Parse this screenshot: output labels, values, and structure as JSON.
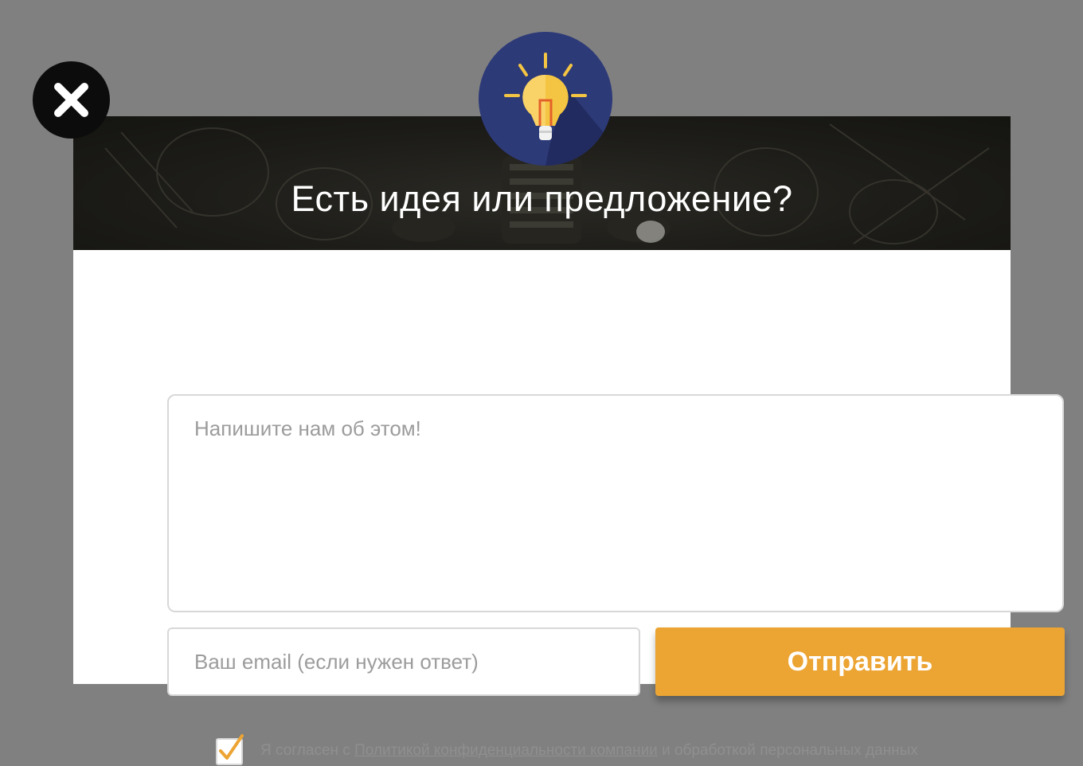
{
  "modal": {
    "title": "Есть идея или предложение?",
    "icon": "lightbulb-icon",
    "close_icon": "close-icon"
  },
  "form": {
    "message_placeholder": "Напишите нам об этом!",
    "message_value": "",
    "email_placeholder": "Ваш email (если нужен ответ)",
    "email_value": "",
    "submit_label": "Отправить",
    "consent": {
      "checked": true,
      "text_before": "Я согласен с ",
      "link_text": "Политикой конфиденциальности компании",
      "text_after": " и обработкой персональных данных"
    }
  },
  "colors": {
    "overlay": "#808080",
    "accent": "#eca433",
    "logo_bg": "#2d3a78",
    "header_bg": "#1d1c18"
  }
}
